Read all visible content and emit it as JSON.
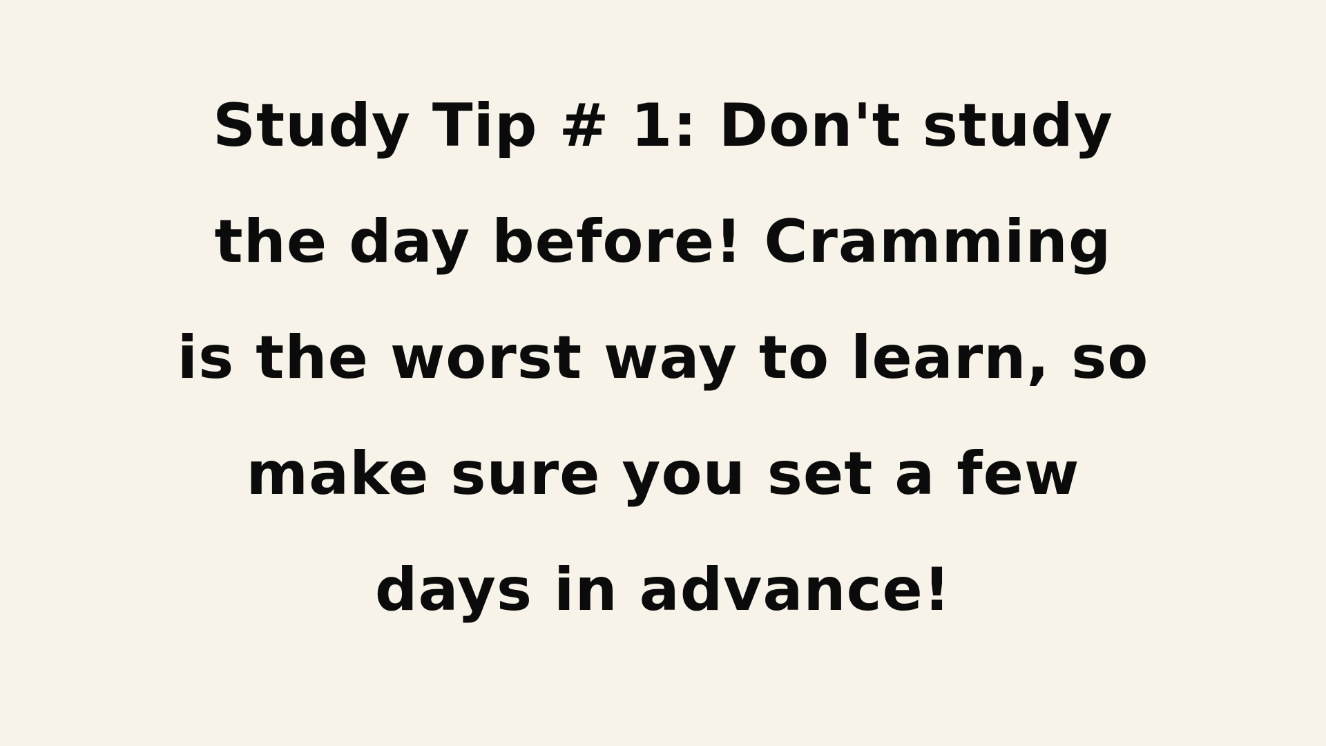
{
  "colors": {
    "background": "#f7f3e9",
    "text": "#0b0b0b"
  },
  "slide": {
    "lines": [
      "Study Tip # 1: Don't study",
      "the day before! Cramming",
      "is the worst way to learn, so",
      "make sure you set a few",
      "days in advance!"
    ]
  }
}
